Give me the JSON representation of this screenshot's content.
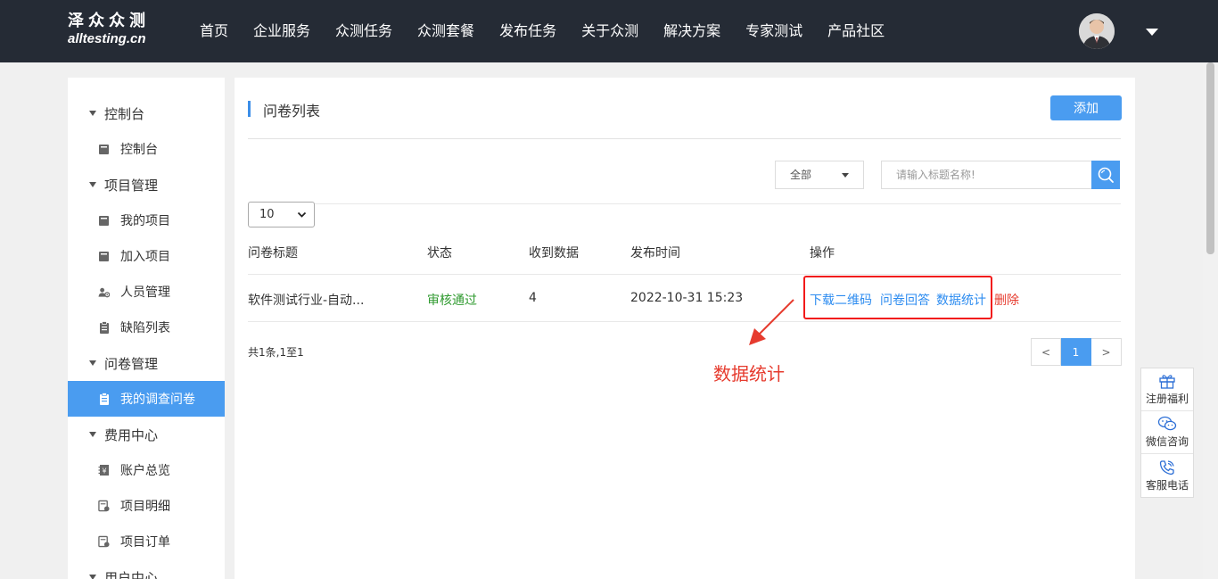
{
  "header": {
    "logo_cn": "泽众众测",
    "logo_en": "alltesting.cn",
    "nav": [
      "首页",
      "企业服务",
      "众测任务",
      "众测套餐",
      "发布任务",
      "关于众测",
      "解决方案",
      "专家测试",
      "产品社区"
    ]
  },
  "sidebar": {
    "groups": [
      {
        "label": "控制台",
        "items": [
          {
            "label": "控制台",
            "icon": "book-icon"
          }
        ]
      },
      {
        "label": "项目管理",
        "items": [
          {
            "label": "我的项目",
            "icon": "book-icon"
          },
          {
            "label": "加入项目",
            "icon": "book-icon"
          },
          {
            "label": "人员管理",
            "icon": "users-gear-icon"
          },
          {
            "label": "缺陷列表",
            "icon": "clipboard-icon"
          }
        ]
      },
      {
        "label": "问卷管理",
        "items": [
          {
            "label": "我的调查问卷",
            "icon": "clipboard-icon",
            "active": true
          }
        ]
      },
      {
        "label": "费用中心",
        "items": [
          {
            "label": "账户总览",
            "icon": "ledger-icon"
          },
          {
            "label": "项目明细",
            "icon": "bill-icon"
          },
          {
            "label": "项目订单",
            "icon": "bill-icon"
          }
        ]
      },
      {
        "label": "用户中心",
        "items": []
      }
    ]
  },
  "main": {
    "title": "问卷列表",
    "add_label": "添加",
    "filter_selected": "全部",
    "search_placeholder": "请输入标题名称!",
    "page_size": "10",
    "columns": [
      "问卷标题",
      "状态",
      "收到数据",
      "发布时间",
      "操作"
    ],
    "rows": [
      {
        "title": "软件测试行业-自动...",
        "status": "审核通过",
        "received": "4",
        "published": "2022-10-31 15:23",
        "actions": [
          "下载二维码",
          "问卷回答",
          "数据统计",
          "删除"
        ]
      }
    ],
    "summary": "共1条,1至1",
    "pager": {
      "prev": "<",
      "current": "1",
      "next": ">"
    },
    "annotation": "数据统计"
  },
  "float_widget": {
    "items": [
      {
        "label": "注册福利",
        "icon": "gift-icon"
      },
      {
        "label": "微信咨询",
        "icon": "wechat-icon"
      },
      {
        "label": "客服电话",
        "icon": "phone-icon"
      }
    ]
  },
  "colors": {
    "header_bg": "#252b35",
    "accent": "#4a9cf0",
    "link": "#2d8cf0",
    "success": "#2f9a2f",
    "danger": "#e63b2e"
  }
}
